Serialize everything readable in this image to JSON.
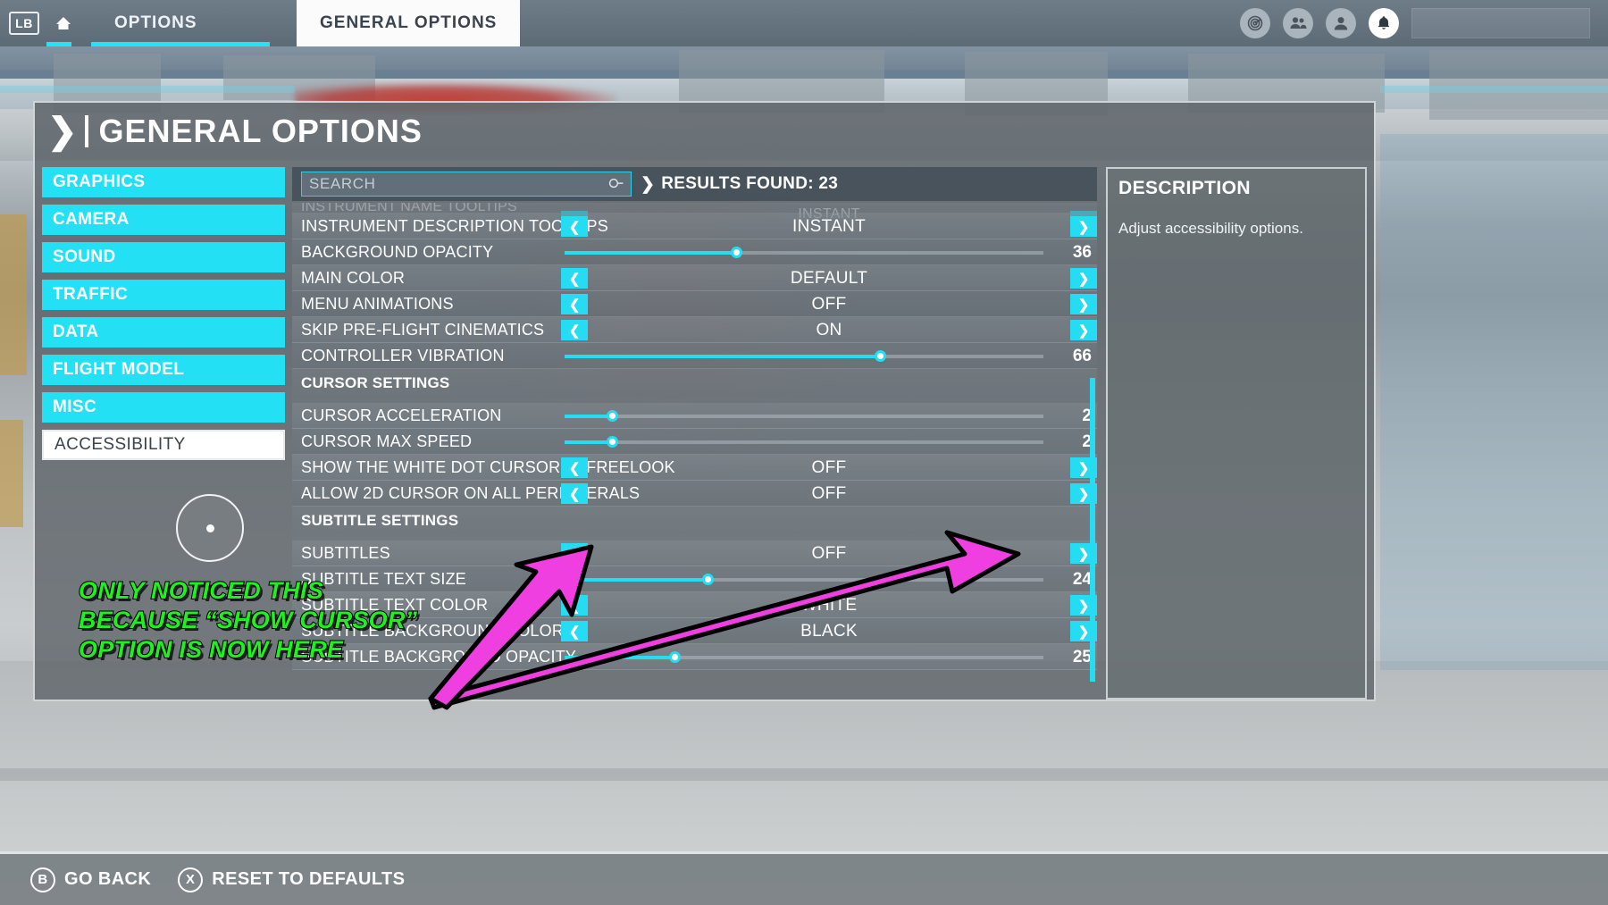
{
  "topbar": {
    "bumper_label": "LB",
    "home_icon": "home-icon",
    "tabs": [
      {
        "label": "OPTIONS",
        "selected": false
      },
      {
        "label": "GENERAL OPTIONS",
        "selected": true
      }
    ],
    "right_icons": [
      {
        "name": "radar-icon",
        "glyph": "◎",
        "active": false
      },
      {
        "name": "friends-icon",
        "glyph": "\u0001",
        "active": false
      },
      {
        "name": "profile-icon",
        "glyph": "\u0002",
        "active": false
      },
      {
        "name": "notifications-bell-icon",
        "glyph": "\u0003",
        "active": true
      }
    ]
  },
  "panel": {
    "title": "GENERAL OPTIONS",
    "back_chevron": "❯"
  },
  "sidebar": {
    "items": [
      {
        "label": "GRAPHICS",
        "selected": false
      },
      {
        "label": "CAMERA",
        "selected": false
      },
      {
        "label": "SOUND",
        "selected": false
      },
      {
        "label": "TRAFFIC",
        "selected": false
      },
      {
        "label": "DATA",
        "selected": false
      },
      {
        "label": "FLIGHT MODEL",
        "selected": false
      },
      {
        "label": "MISC",
        "selected": false
      },
      {
        "label": "ACCESSIBILITY",
        "selected": true
      }
    ]
  },
  "search": {
    "placeholder": "SEARCH",
    "value": "",
    "icon": "search-icon",
    "results_label": "RESULTS FOUND: 23",
    "results_chevron": "❯"
  },
  "settings_rows": [
    {
      "type": "clipped",
      "label": "INSTRUMENT NAME TOOLTIPS",
      "control": "selector",
      "value": "INSTANT"
    },
    {
      "type": "selector",
      "label": "INSTRUMENT DESCRIPTION TOOLTIPS",
      "value": "INSTANT"
    },
    {
      "type": "slider",
      "label": "BACKGROUND OPACITY",
      "value": "36",
      "percent": 36
    },
    {
      "type": "selector",
      "label": "MAIN COLOR",
      "value": "DEFAULT"
    },
    {
      "type": "selector",
      "label": "MENU ANIMATIONS",
      "value": "OFF"
    },
    {
      "type": "selector",
      "label": "SKIP PRE-FLIGHT CINEMATICS",
      "value": "ON"
    },
    {
      "type": "slider",
      "label": "CONTROLLER VIBRATION",
      "value": "66",
      "percent": 66
    },
    {
      "type": "section",
      "label": "CURSOR SETTINGS"
    },
    {
      "type": "slider",
      "label": "CURSOR ACCELERATION",
      "value": "2",
      "percent": 10
    },
    {
      "type": "slider",
      "label": "CURSOR MAX SPEED",
      "value": "2",
      "percent": 10
    },
    {
      "type": "selector",
      "label": "SHOW THE WHITE DOT CURSOR IN FREELOOK",
      "value": "OFF"
    },
    {
      "type": "selector",
      "label": "ALLOW 2D CURSOR ON ALL PERIPHERALS",
      "value": "OFF"
    },
    {
      "type": "section",
      "label": "SUBTITLE SETTINGS"
    },
    {
      "type": "selector",
      "label": "SUBTITLES",
      "value": "OFF"
    },
    {
      "type": "slider",
      "label": "SUBTITLE TEXT SIZE",
      "value": "24",
      "percent": 30
    },
    {
      "type": "selector",
      "label": "SUBTITLE TEXT COLOR",
      "value": "WHITE"
    },
    {
      "type": "selector",
      "label": "SUBTITLE BACKGROUND COLOR",
      "value": "BLACK"
    },
    {
      "type": "slider",
      "label": "SUBTITLE BACKGROUND OPACITY",
      "value": "25",
      "percent": 23
    }
  ],
  "description": {
    "title": "DESCRIPTION",
    "text": "Adjust accessibility options."
  },
  "bottombar": {
    "hints": [
      {
        "key": "B",
        "label": "GO BACK"
      },
      {
        "key": "X",
        "label": "RESET TO DEFAULTS"
      }
    ]
  },
  "annotation": {
    "text": "ONLY NOTICED THIS\nBECAUSE “SHOW CURSOR”\nOPTION IS NOW HERE",
    "color": "#1ff01f",
    "arrow_color": "#ef3fe0"
  },
  "colors": {
    "accent_cyan": "#25dcf3",
    "selected_white": "#ffffff",
    "annotation_green": "#1ff01f",
    "annotation_magenta": "#ef3fe0"
  }
}
